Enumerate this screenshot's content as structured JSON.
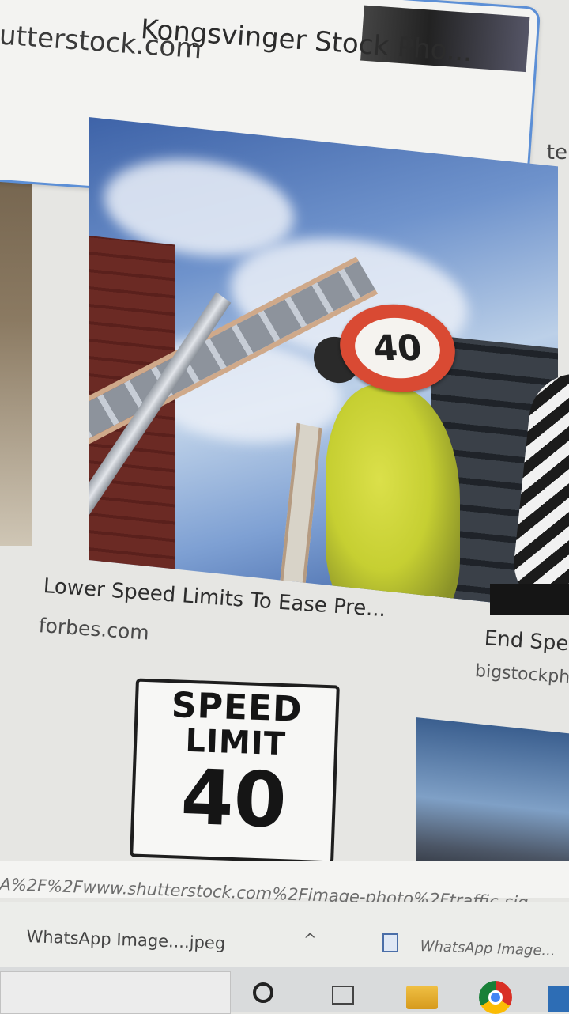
{
  "top_result": {
    "title": "Kongsvinger Stock Pho...",
    "source": "utterstock.com"
  },
  "edge_text": "te",
  "main_result": {
    "sign_value": "40",
    "caption": "Lower Speed Limits To Ease Pre...",
    "source": "forbes.com"
  },
  "right_result": {
    "caption": "End Spe",
    "source": "bigstockph"
  },
  "second_row": {
    "speed_sign": {
      "line1": "SPEED",
      "line2": "LIMIT",
      "line3": "40"
    }
  },
  "url_bar": {
    "text": "A%2F%2Fwww.shutterstock.com%2Fimage-photo%2Ftraffic-sig"
  },
  "downloads": {
    "item1": "WhatsApp Image....jpeg",
    "chevron": "^",
    "item2": "WhatsApp Image..."
  },
  "taskbar": {
    "icons": [
      "cortana-icon",
      "task-view-icon",
      "file-explorer-icon",
      "chrome-icon",
      "app-icon"
    ]
  }
}
